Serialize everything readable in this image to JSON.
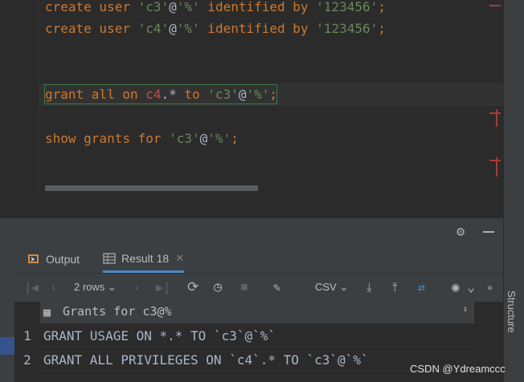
{
  "editor": {
    "line1": {
      "kw1": "create user ",
      "str1": "'c3'",
      "at": "@",
      "str2": "'%'",
      "kw2": " identified by ",
      "str3": "'123456'",
      "semi": ";"
    },
    "line2": {
      "kw1": "create user ",
      "str1": "'c4'",
      "at": "@",
      "str2": "'%'",
      "kw2": " identified by ",
      "str3": "'123456'",
      "semi": ";"
    },
    "line3": {
      "kw1": "grant all on ",
      "id": "c4",
      "rest": ".*",
      "kw2": " to ",
      "str1": "'c3'",
      "at": "@",
      "str2": "'%'",
      "semi": ";"
    },
    "line4": {
      "kw1": "show grants for ",
      "str1": "'c3'",
      "at": "@",
      "str2": "'%'",
      "semi": ";"
    }
  },
  "tabs": [
    {
      "label": "Output",
      "icon": "output-icon"
    },
    {
      "label": "Result 18",
      "icon": "table-icon",
      "close": "✕"
    }
  ],
  "toolbar": {
    "rows_label": "2 rows",
    "export_format": "CSV"
  },
  "grid": {
    "column_header": "Grants for c3@%",
    "rows": [
      {
        "num": "1",
        "value": "GRANT USAGE ON *.* TO `c3`@`%`"
      },
      {
        "num": "2",
        "value": "GRANT ALL PRIVILEGES ON `c4`.* TO `c3`@`%`"
      }
    ]
  },
  "side_panel_label": "Structure",
  "watermark": "CSDN @Ydreamccc",
  "colors": {
    "keyword": "#cc7832",
    "string": "#6a8759",
    "identifier": "#c0504d",
    "accent": "#4a88c7"
  }
}
